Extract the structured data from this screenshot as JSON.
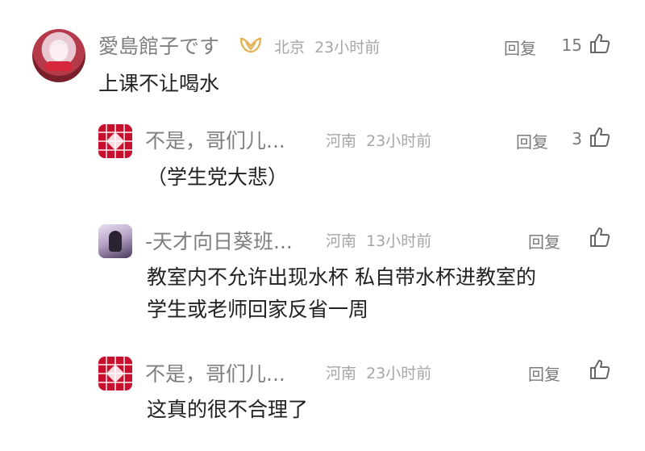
{
  "comments": [
    {
      "username": "愛島館子です",
      "location": "北京",
      "time": "23小时前",
      "reply_label": "回复",
      "like_count": "15",
      "content": "上课不让喝水",
      "icons": [
        "avatar",
        "vip-badge-icon",
        "thumbs-up-icon"
      ]
    }
  ],
  "replies": [
    {
      "username": "不是，哥们儿...",
      "location": "河南",
      "time": "23小时前",
      "reply_label": "回复",
      "like_count": "3",
      "content_lines": [
        "（学生党大悲）"
      ]
    },
    {
      "username": "-天才向日葵班...",
      "location": "河南",
      "time": "13小时前",
      "reply_label": "回复",
      "like_count": "",
      "content_lines": [
        "教室内不允许出现水杯  私自带水杯进教室的",
        "学生或老师回家反省一周"
      ]
    },
    {
      "username": "不是，哥们儿...",
      "location": "河南",
      "time": "23小时前",
      "reply_label": "回复",
      "like_count": "",
      "content_lines": [
        "这真的很不合理了"
      ]
    }
  ],
  "colors": {
    "badge": "#e3b45a",
    "meta_text": "#a6a6a6",
    "username": "#7f7f7f",
    "content": "#222222"
  }
}
